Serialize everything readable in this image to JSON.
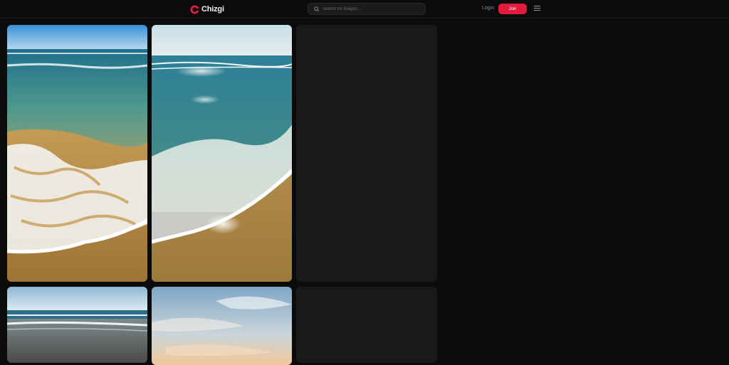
{
  "brand": {
    "name": "Chizgi",
    "accent": "#e31b3e"
  },
  "search": {
    "placeholder": "Search for images...",
    "value": ""
  },
  "nav": {
    "login_label": "Login",
    "join_label": "Join"
  },
  "icons": {
    "logo": "chizgi-logo-icon",
    "search": "search-icon",
    "menu": "hamburger-menu-icon"
  },
  "gallery": {
    "items": [
      {
        "kind": "photo",
        "subject": "beach waves washing on sand"
      },
      {
        "kind": "photo",
        "subject": "sunlit ocean wave on beach"
      },
      {
        "kind": "placeholder"
      },
      {
        "kind": "photo",
        "subject": "wide beach shoreline"
      },
      {
        "kind": "photo",
        "subject": "sky with clouds at sunset"
      },
      {
        "kind": "placeholder"
      }
    ]
  }
}
